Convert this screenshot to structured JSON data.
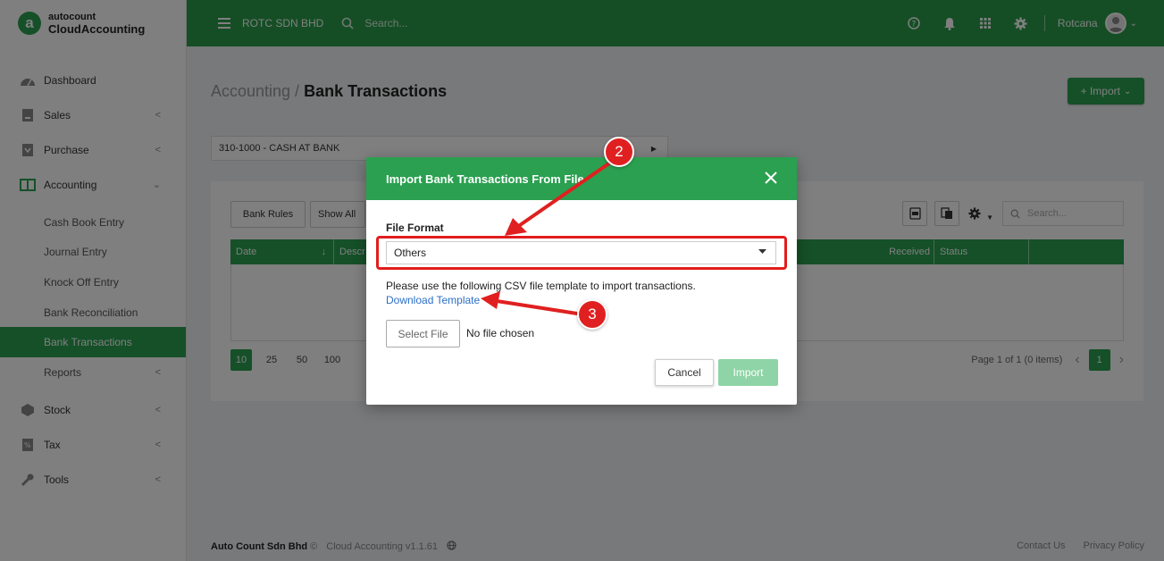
{
  "logo": {
    "mark": "a",
    "line1": "autocount",
    "line2": "CloudAccounting"
  },
  "sidebar": {
    "items": [
      {
        "label": "Dashboard",
        "icon": "dashboard-icon"
      },
      {
        "label": "Sales",
        "icon": "sales-icon"
      },
      {
        "label": "Purchase",
        "icon": "purchase-icon"
      },
      {
        "label": "Accounting",
        "icon": "accounting-icon"
      }
    ],
    "sub_items": [
      "Cash Book Entry",
      "Journal Entry",
      "Knock Off Entry",
      "Bank Reconciliation",
      "Bank Transactions",
      "Reports"
    ],
    "bottom_items": [
      {
        "label": "Stock",
        "icon": "stock-icon"
      },
      {
        "label": "Tax",
        "icon": "tax-icon"
      },
      {
        "label": "Tools",
        "icon": "wrench-icon"
      }
    ]
  },
  "topbar": {
    "company": "ROTC SDN BHD",
    "search_placeholder": "Search...",
    "username": "Rotcana"
  },
  "page": {
    "breadcrumb": "Accounting /",
    "title": "Bank Transactions",
    "import_label": "+ Import",
    "account": "310-1000 - CASH AT BANK"
  },
  "card": {
    "bank_rules": "Bank Rules",
    "show_all": "Show All",
    "search_placeholder": "Search...",
    "columns": {
      "date": "Date",
      "desc": "Descr",
      "received": "Received",
      "status": "Status"
    },
    "page_sizes": [
      "10",
      "25",
      "50",
      "100"
    ],
    "page_info": "Page 1 of 1 (0 items)",
    "current_page": "1"
  },
  "footer": {
    "company": "Auto Count Sdn Bhd",
    "copyright": "©",
    "version": "Cloud Accounting v1.1.61",
    "contact": "Contact Us",
    "privacy": "Privacy Policy"
  },
  "modal": {
    "title": "Import Bank Transactions From File",
    "file_format_label": "File Format",
    "file_format_value": "Others",
    "help_text": "Please use the following CSV file template to import transactions.",
    "download_link": "Download Template",
    "select_file": "Select File",
    "no_file": "No file chosen",
    "cancel": "Cancel",
    "import": "Import"
  },
  "annotations": {
    "badge2": "2",
    "badge3": "3"
  },
  "colors": {
    "brand": "#2aa050",
    "annotation": "#e02020"
  }
}
